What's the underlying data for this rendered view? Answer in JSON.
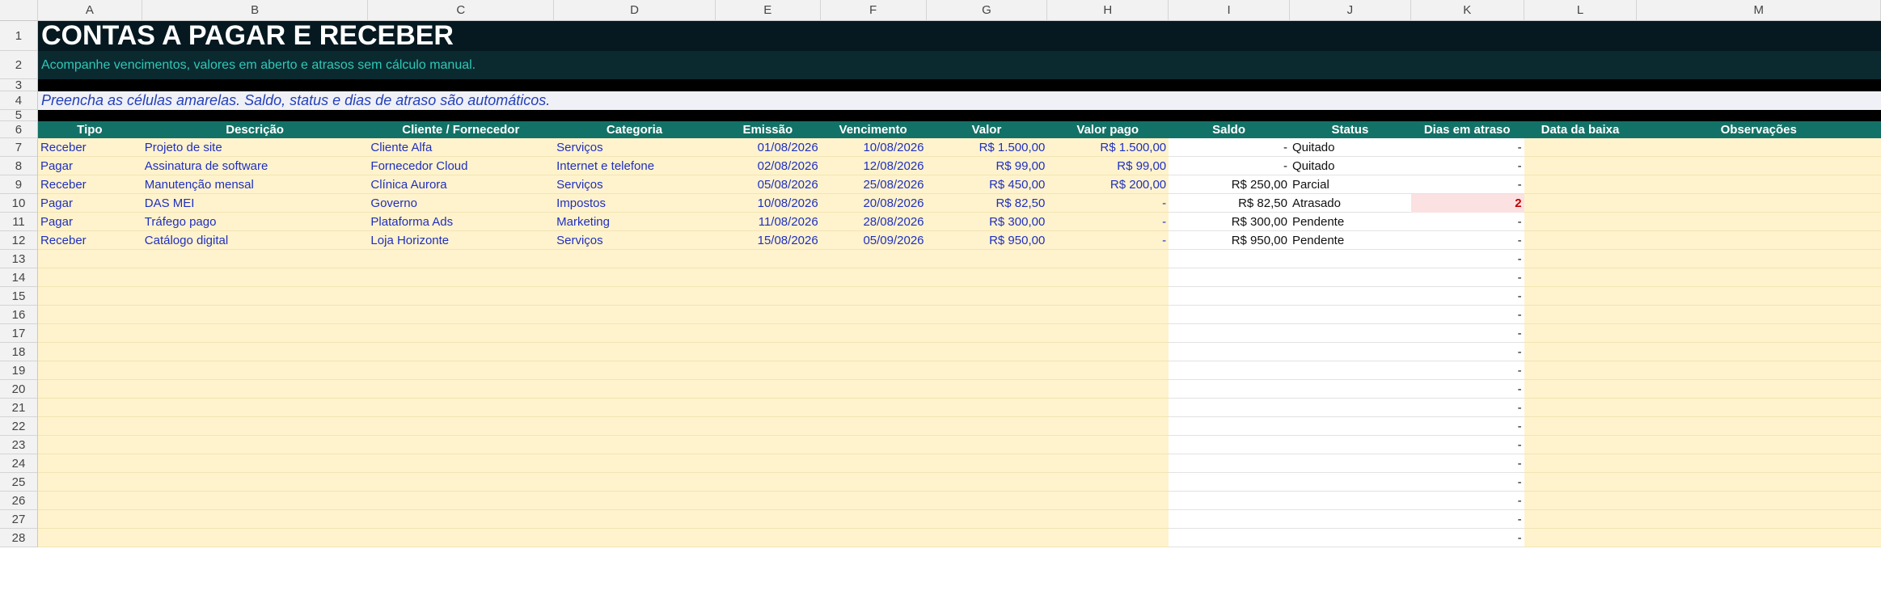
{
  "columns": [
    "A",
    "B",
    "C",
    "D",
    "E",
    "F",
    "G",
    "H",
    "I",
    "J",
    "K",
    "L",
    "M"
  ],
  "title": "CONTAS A PAGAR E RECEBER",
  "subtitle": "Acompanhe vencimentos, valores em aberto e atrasos sem cálculo manual.",
  "note": "Preencha as células amarelas. Saldo, status e dias de atraso são automáticos.",
  "headers": [
    "Tipo",
    "Descrição",
    "Cliente / Fornecedor",
    "Categoria",
    "Emissão",
    "Vencimento",
    "Valor",
    "Valor pago",
    "Saldo",
    "Status",
    "Dias em atraso",
    "Data da baixa",
    "Observações"
  ],
  "rows": [
    [
      "Receber",
      "Projeto de site",
      "Cliente Alfa",
      "Serviços",
      "01/08/2026",
      "10/08/2026",
      "R$ 1.500,00",
      "R$ 1.500,00",
      "-",
      "Quitado",
      "-",
      "",
      ""
    ],
    [
      "Pagar",
      "Assinatura de software",
      "Fornecedor Cloud",
      "Internet e telefone",
      "02/08/2026",
      "12/08/2026",
      "R$ 99,00",
      "R$ 99,00",
      "-",
      "Quitado",
      "-",
      "",
      ""
    ],
    [
      "Receber",
      "Manutenção mensal",
      "Clínica Aurora",
      "Serviços",
      "05/08/2026",
      "25/08/2026",
      "R$ 450,00",
      "R$ 200,00",
      "R$ 250,00",
      "Parcial",
      "-",
      "",
      ""
    ],
    [
      "Pagar",
      "DAS MEI",
      "Governo",
      "Impostos",
      "10/08/2026",
      "20/08/2026",
      "R$ 82,50",
      "-",
      "R$ 82,50",
      "Atrasado",
      "2",
      "",
      ""
    ],
    [
      "Pagar",
      "Tráfego pago",
      "Plataforma Ads",
      "Marketing",
      "11/08/2026",
      "28/08/2026",
      "R$ 300,00",
      "-",
      "R$ 300,00",
      "Pendente",
      "-",
      "",
      ""
    ],
    [
      "Receber",
      "Catálogo digital",
      "Loja Horizonte",
      "Serviços",
      "15/08/2026",
      "05/09/2026",
      "R$ 950,00",
      "-",
      "R$ 950,00",
      "Pendente",
      "-",
      "",
      ""
    ]
  ],
  "empty_days_value": "-",
  "late_status": "Atrasado"
}
